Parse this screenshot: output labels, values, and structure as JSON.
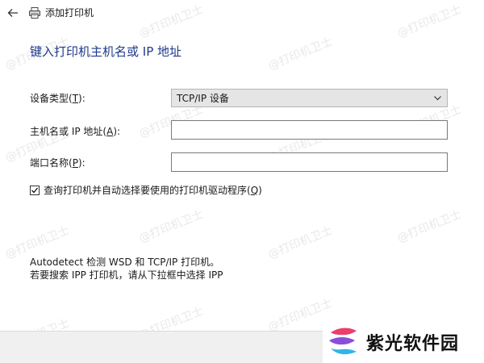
{
  "window": {
    "title": "添加打印机",
    "heading": "键入打印机主机名或 IP 地址"
  },
  "form": {
    "device_type": {
      "label_prefix": "设备类型(",
      "accel": "T",
      "label_suffix": "):",
      "selected": "TCP/IP 设备"
    },
    "hostname": {
      "label_prefix": "主机名或 IP 地址(",
      "accel": "A",
      "label_suffix": "):",
      "value": ""
    },
    "port_name": {
      "label_prefix": "端口名称(",
      "accel": "P",
      "label_suffix": "):",
      "value": ""
    },
    "auto_driver": {
      "label_prefix": "查询打印机并自动选择要使用的打印机驱动程序(",
      "accel": "Q",
      "label_suffix": ")",
      "checked": true
    }
  },
  "info": {
    "line1": "Autodetect 检测 WSD 和 TCP/IP 打印机。",
    "line2": "若要搜索 IPP 打印机，请从下拉框中选择 IPP"
  },
  "watermark": {
    "text": "@打印机卫士"
  },
  "logo": {
    "text": "紫光软件园"
  },
  "colors": {
    "heading": "#1e3a8a",
    "select_bg": "#e5e5e5",
    "footer_bg": "#f0f0f0"
  },
  "icons": {
    "back": "back-arrow-icon",
    "printer": "printer-icon",
    "dropdown": "chevron-down-icon",
    "check": "checkmark-icon"
  }
}
